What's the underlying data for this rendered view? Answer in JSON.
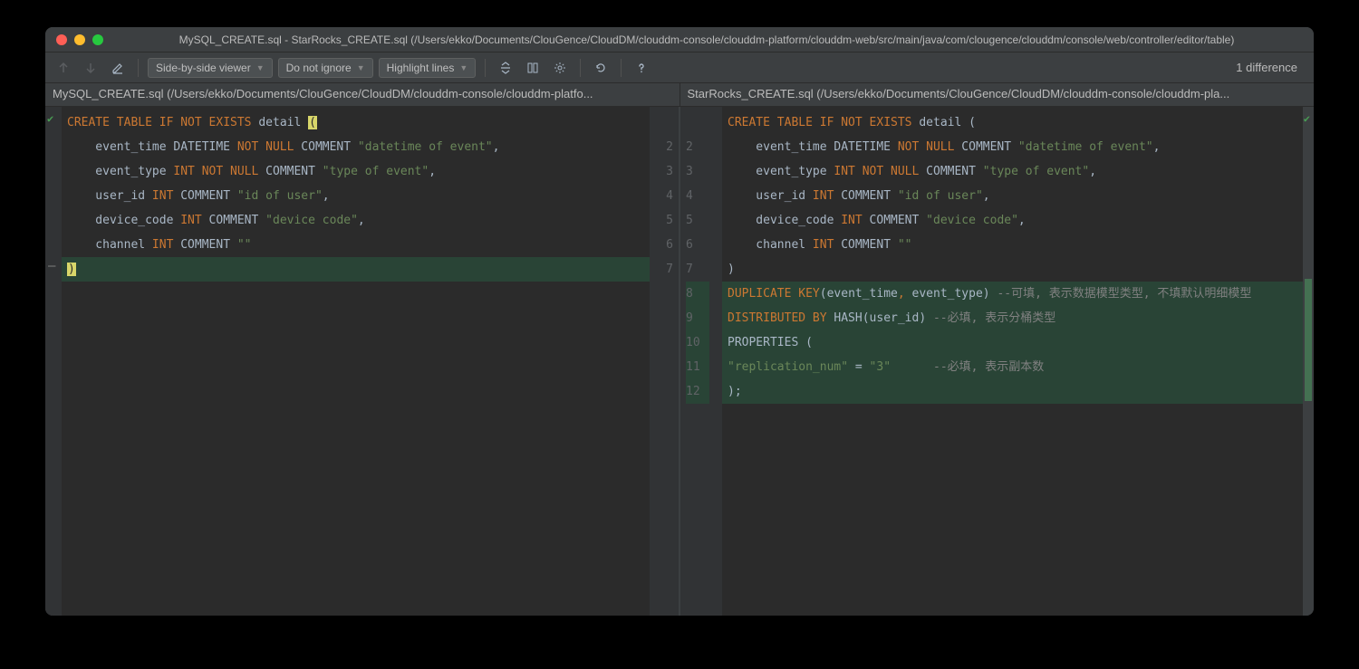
{
  "window": {
    "title": "MySQL_CREATE.sql - StarRocks_CREATE.sql (/Users/ekko/Documents/ClouGence/CloudDM/clouddm-console/clouddm-platform/clouddm-web/src/main/java/com/clougence/clouddm/console/web/controller/editor/table)"
  },
  "toolbar": {
    "viewer_mode": "Side-by-side viewer",
    "ignore_mode": "Do not ignore",
    "highlight_mode": "Highlight lines",
    "diff_count": "1 difference"
  },
  "files": {
    "left": "MySQL_CREATE.sql (/Users/ekko/Documents/ClouGence/CloudDM/clouddm-console/clouddm-platfo...",
    "right": "StarRocks_CREATE.sql (/Users/ekko/Documents/ClouGence/CloudDM/clouddm-console/clouddm-pla..."
  },
  "left_lines": [
    "",
    "2",
    "3",
    "4",
    "5",
    "6",
    "7"
  ],
  "right_lines": [
    "",
    "2",
    "3",
    "4",
    "5",
    "6",
    "7",
    "8",
    "9",
    "10",
    "11",
    "12"
  ],
  "code": {
    "l1_kw1": "CREATE TABLE",
    "l1_kw2": "IF",
    "l1_kw3": "NOT EXISTS",
    "l1_ident": " detail ",
    "l1_paren": "(",
    "l2_pre": "    event_time DATETIME ",
    "l2_kw": "NOT NULL",
    "l2_mid": " COMMENT ",
    "l2_str": "\"datetime of event\"",
    "l2_end": ",",
    "l3_pre": "    event_type ",
    "l3_type": "INT",
    "l3_kw": " NOT NULL",
    "l3_mid": " COMMENT ",
    "l3_str": "\"type of event\"",
    "l3_end": ",",
    "l4_pre": "    user_id ",
    "l4_type": "INT",
    "l4_mid": " COMMENT ",
    "l4_str": "\"id of user\"",
    "l4_end": ",",
    "l5_pre": "    device_code ",
    "l5_type": "INT",
    "l5_mid": " COMMENT ",
    "l5_str": "\"device code\"",
    "l5_end": ",",
    "l6_pre": "    channel ",
    "l6_type": "INT",
    "l6_mid": " COMMENT ",
    "l6_str": "\"\"",
    "l7_paren": ")",
    "r1_kw1": "CREATE TABLE",
    "r1_kw2": "IF",
    "r1_kw3": "NOT EXISTS",
    "r1_rest": " detail (",
    "r7": ")",
    "r8_kw1": "DUPLICATE",
    "r8_kw2": " KEY",
    "r8_mid": "(event_time",
    "r8_comma": ",",
    "r8_mid2": " event_type) ",
    "r8_cmt": "--可填, 表示数据模型类型, 不填默认明细模型",
    "r9_kw1": "DISTRIBUTED",
    "r9_kw2": " BY",
    "r9_mid": " HASH(user_id) ",
    "r9_cmt": "--必填, 表示分桶类型",
    "r10": "PROPERTIES (",
    "r11_str": "\"replication_num\"",
    "r11_mid": " = ",
    "r11_str2": "\"3\"",
    "r11_sp": "      ",
    "r11_cmt": "--必填, 表示副本数",
    "r12": ");"
  }
}
